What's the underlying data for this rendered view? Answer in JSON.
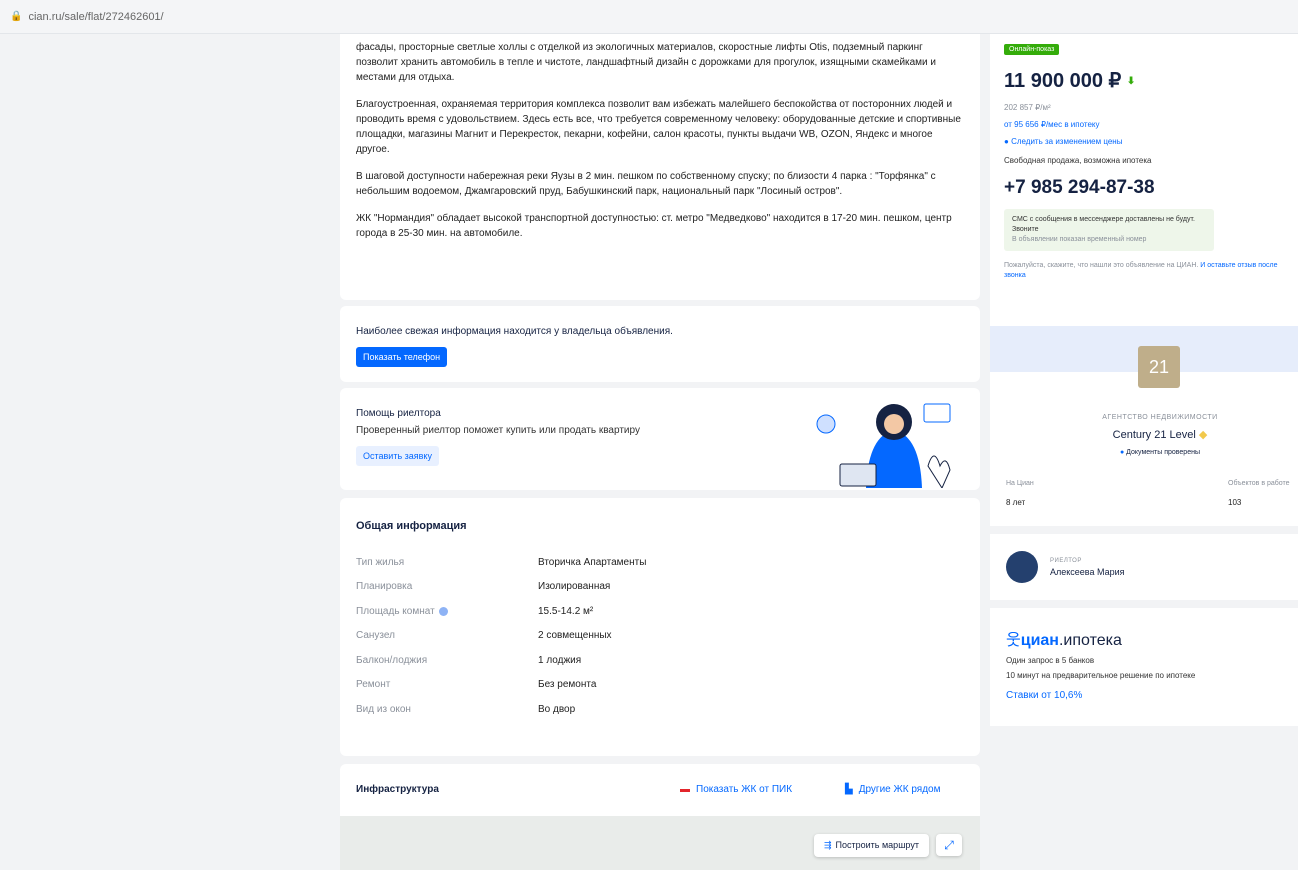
{
  "url": "cian.ru/sale/flat/272462601/",
  "description": {
    "paragraphs": [
      "фасады, просторные светлые холлы с отделкой из экологичных материалов, скоростные лифты Otis, подземный паркинг позволит хранить автомобиль в тепле и чистоте, ландшафтный дизайн с дорожками для прогулок, изящными скамейками и местами для отдыха.",
      "Благоустроенная, охраняемая территория комплекса позволит вам избежать малейшего беспокойства от посторонних людей и проводить время с удовольствием. Здесь есть все, что требуется современному человеку: оборудованные детские и спортивные площадки, магазины Магнит и Перекресток, пекарни, кофейни, салон красоты, пункты выдачи WB, OZON, Яндекс и многое другое.",
      "В шаговой доступности набережная реки Яузы в 2 мин. пешком по собственному спуску; по близости 4 парка : \"Торфянка\" с небольшим водоемом, Джамгаровский пруд, Бабушкинский парк, национальный парк \"Лосиный остров\".",
      "ЖК \"Нормандия\" обладает высокой транспортной доступностью: ст. метро \"Медведково\" находится в 17-20 мин. пешком, центр города в 25-30 мин. на автомобиле."
    ]
  },
  "freshness": {
    "text": "Наиболее свежая информация находится у владельца объявления.",
    "button": "Показать телефон"
  },
  "realtor_help": {
    "title": "Помощь риелтора",
    "subtitle": "Проверенный риелтор поможет купить или продать квартиру",
    "button": "Оставить заявку"
  },
  "general": {
    "title": "Общая информация",
    "rows": [
      {
        "key": "Тип жилья",
        "value": "Вторичка Апартаменты"
      },
      {
        "key": "Планировка",
        "value": "Изолированная"
      },
      {
        "key": "Площадь комнат",
        "value": "15.5-14.2 м²"
      },
      {
        "key": "Санузел",
        "value": "2 совмещенных"
      },
      {
        "key": "Балкон/лоджия",
        "value": "1 лоджия"
      },
      {
        "key": "Ремонт",
        "value": "Без ремонта"
      },
      {
        "key": "Вид из окон",
        "value": "Во двор"
      }
    ]
  },
  "infrastructure": {
    "title": "Инфраструктура",
    "link_pik": "Показать ЖК от ПИК",
    "link_other": "Другие ЖК рядом",
    "route_button": "Построить маршрут"
  },
  "sidebar": {
    "badge": "Онлайн-показ",
    "price": "11 900 000 ₽",
    "price_per_m": "202 857 ₽/м²",
    "mortgage_link": "от 95 656 ₽/мес в ипотеку",
    "watch_price": "Следить за изменением цены",
    "sale_type": "Свободная продажа, возможна ипотека",
    "phone": "+7 985 294-87-38",
    "sms_title": "СМС с сообщения в мессенджере доставлены не будут. Звоните",
    "sms_sub": "В объявлении показан временный номер",
    "report_text": "Пожалуйста, скажите, что нашли это объявление на ЦИАН.",
    "report_link": "И оставьте отзыв после звонка"
  },
  "agency": {
    "logo": "21",
    "type": "АГЕНТСТВО НЕДВИЖИМОСТИ",
    "name": "Century 21 Level",
    "docs": "Документы проверены",
    "stat1_label": "На Циан",
    "stat1_value": "8 лет",
    "stat2_label": "Объектов в работе",
    "stat2_value": "103"
  },
  "realtor": {
    "role": "РИЕЛТОР",
    "name": "Алексеева Мария"
  },
  "mortgage": {
    "brand_a": "циан",
    "brand_b": ".ипотека",
    "line1": "Один запрос в 5 банков",
    "line2": "10 минут на предварительное решение по ипотеке",
    "rate": "Ставки от 10,6%"
  },
  "colors": {
    "accent": "#0468ff",
    "badge": "#34ac0a"
  }
}
